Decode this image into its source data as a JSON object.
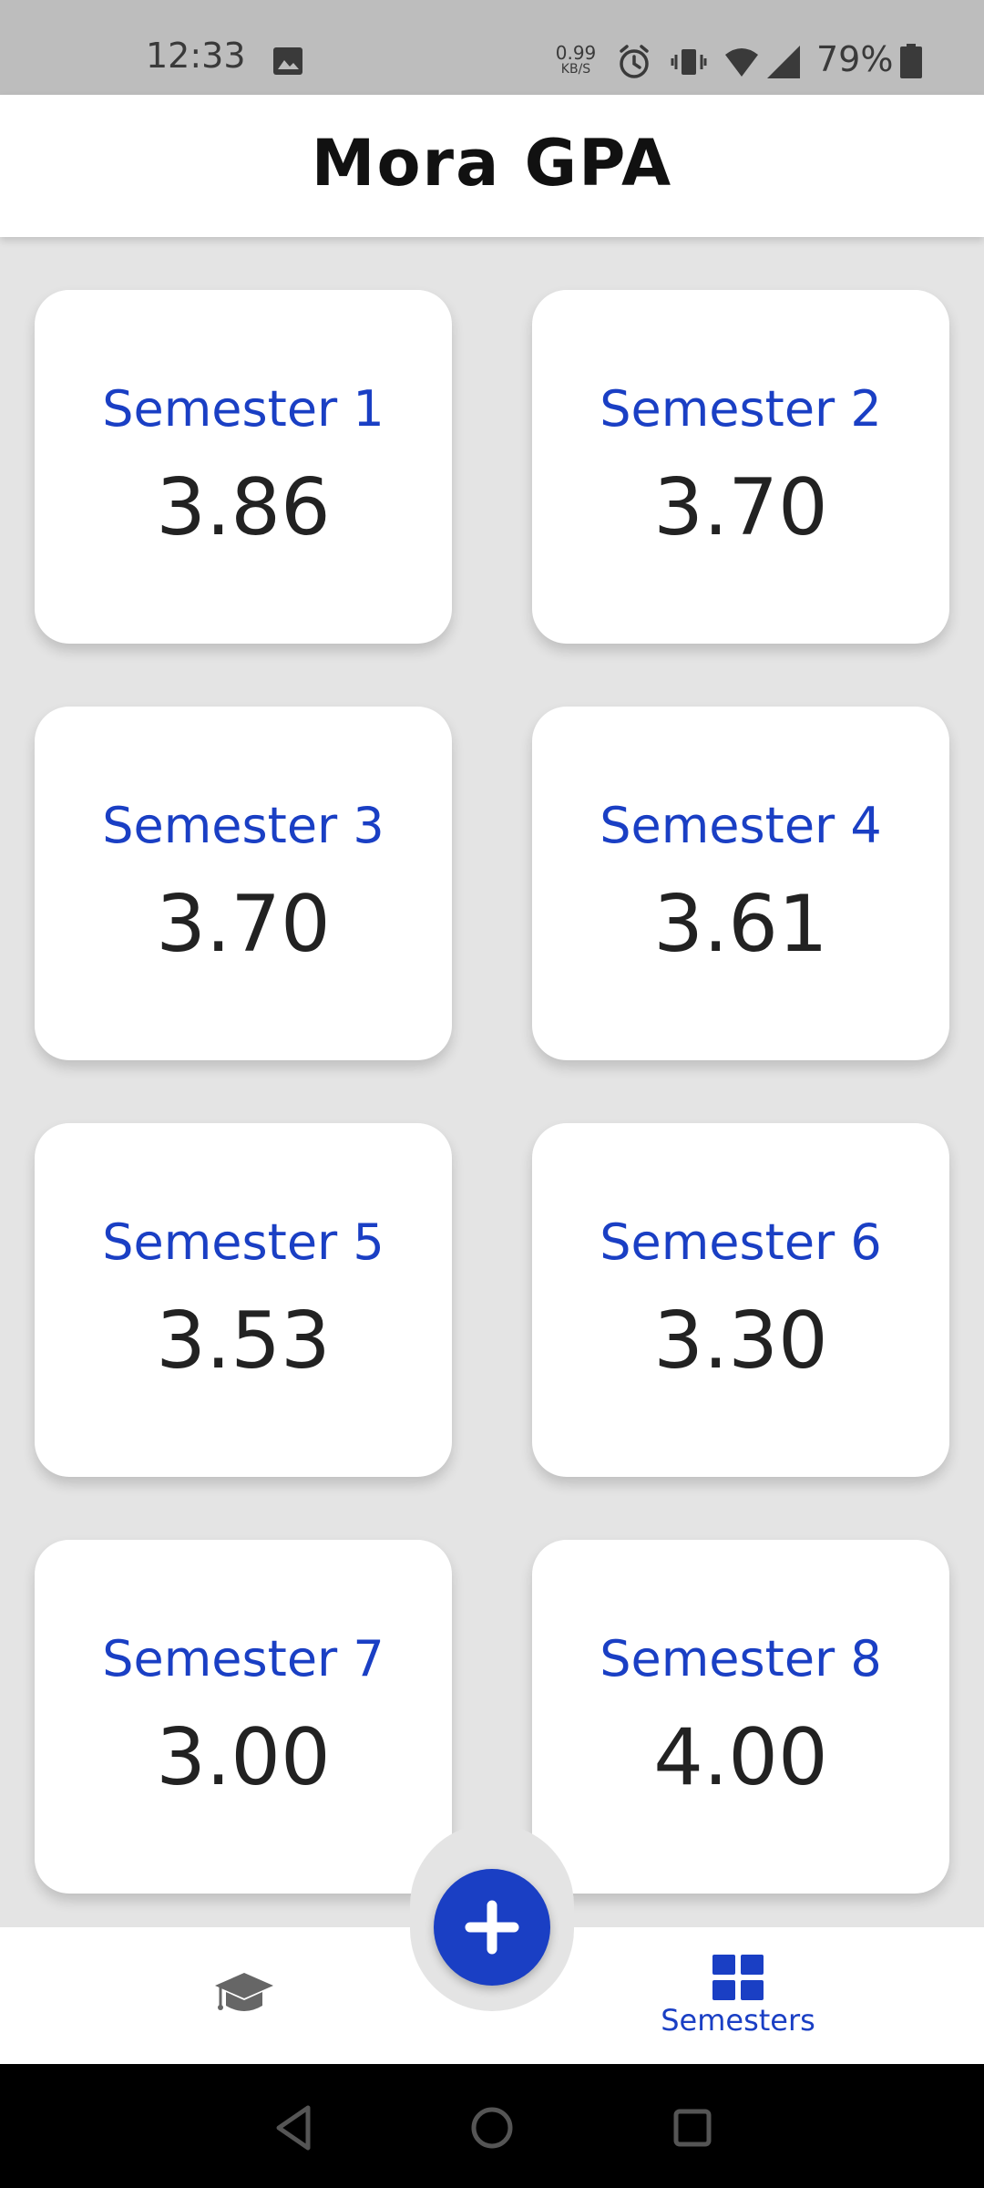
{
  "status_bar": {
    "time": "12:33",
    "speed_value": "0.99",
    "speed_unit": "KB/S",
    "battery": "79%",
    "icons": [
      "image-icon",
      "alarm-icon",
      "vibrate-icon",
      "wifi-icon",
      "signal-icon",
      "battery-icon"
    ]
  },
  "app": {
    "title": "Mora GPA"
  },
  "semesters": [
    {
      "label": "Semester 1",
      "gpa": "3.86"
    },
    {
      "label": "Semester 2",
      "gpa": "3.70"
    },
    {
      "label": "Semester 3",
      "gpa": "3.70"
    },
    {
      "label": "Semester 4",
      "gpa": "3.61"
    },
    {
      "label": "Semester 5",
      "gpa": "3.53"
    },
    {
      "label": "Semester 6",
      "gpa": "3.30"
    },
    {
      "label": "Semester 7",
      "gpa": "3.00"
    },
    {
      "label": "Semester 8",
      "gpa": "4.00"
    }
  ],
  "bottom_nav": {
    "gpa_icon": "graduation-cap-icon",
    "fab_icon": "plus-icon",
    "semesters_icon": "grid-icon",
    "semesters_label": "Semesters"
  },
  "colors": {
    "accent": "#1a3fc4",
    "background": "#e4e4e4",
    "card": "#ffffff"
  }
}
